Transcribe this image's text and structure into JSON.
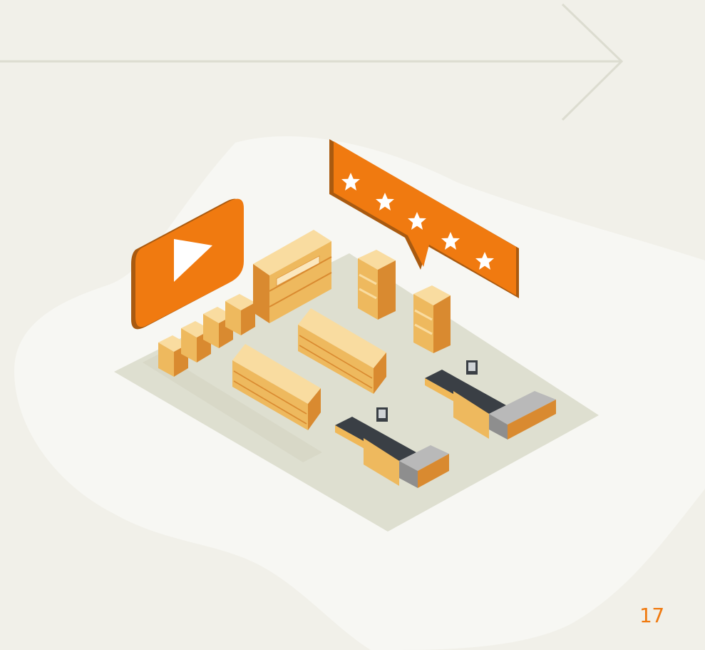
{
  "page": {
    "number": "17"
  },
  "colors": {
    "background": "#f1f0e9",
    "blob": "#f7f7f3",
    "accent": "#f07a10",
    "accent_dark": "#a95a10",
    "floor": "#dedfd0",
    "floor_shadow": "#c9c9b6",
    "wood_light": "#f9dca0",
    "wood_mid": "#eeb95e",
    "wood_dark": "#d98a30",
    "arrow": "#dcdcd0",
    "page_number": "#f07a10"
  },
  "illustration": {
    "video_badge": {
      "icon": "play-icon"
    },
    "rating_banner": {
      "icon": "star-icon",
      "stars": 5
    },
    "checkout_counters": 2,
    "display_towers": 2,
    "aisle_shelves": 2,
    "boxes": 4
  }
}
